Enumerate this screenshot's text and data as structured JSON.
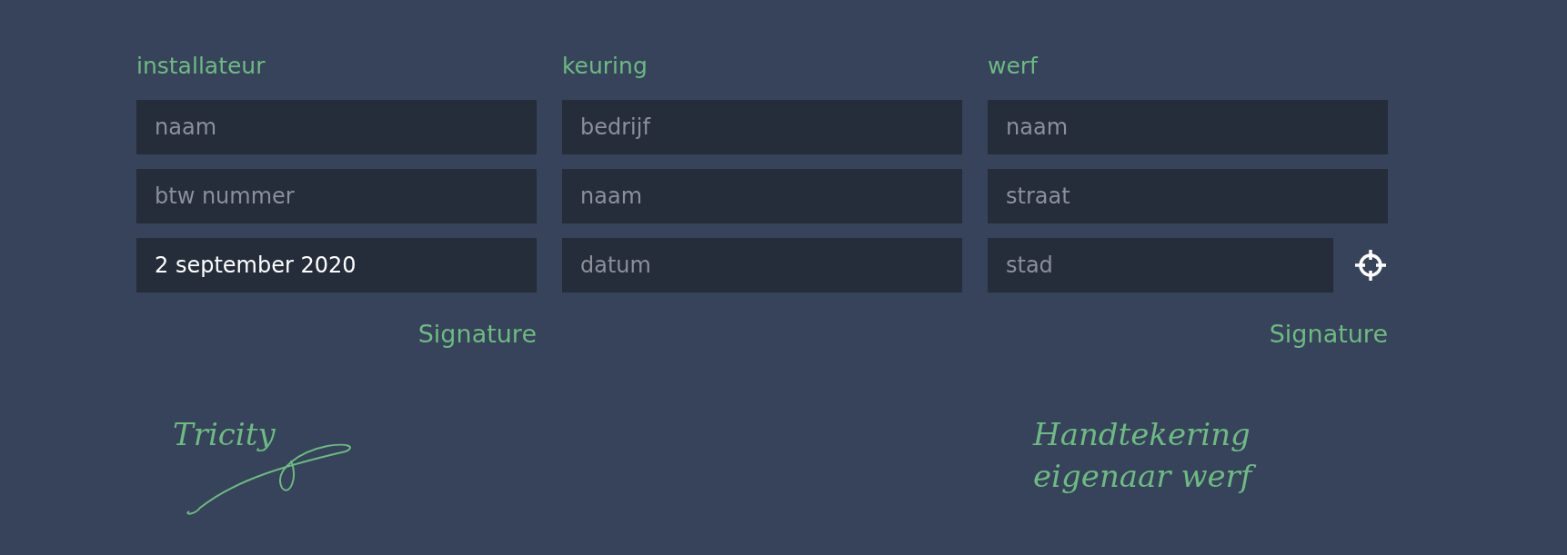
{
  "columns": [
    {
      "title": "installateur",
      "fields": [
        {
          "placeholder": "naam"
        },
        {
          "placeholder": "btw nummer"
        },
        {
          "value": "2 september 2020"
        }
      ],
      "signature_label": "Signature",
      "signature": "Tricity"
    },
    {
      "title": "keuring",
      "fields": [
        {
          "placeholder": "bedrijf"
        },
        {
          "placeholder": "naam"
        },
        {
          "placeholder": "datum"
        }
      ]
    },
    {
      "title": "werf",
      "fields": [
        {
          "placeholder": "naam"
        },
        {
          "placeholder": "straat"
        },
        {
          "placeholder": "stad",
          "locate_button": true
        }
      ],
      "signature_label": "Signature",
      "signature": "Handtekering eigenaar werf"
    }
  ]
}
